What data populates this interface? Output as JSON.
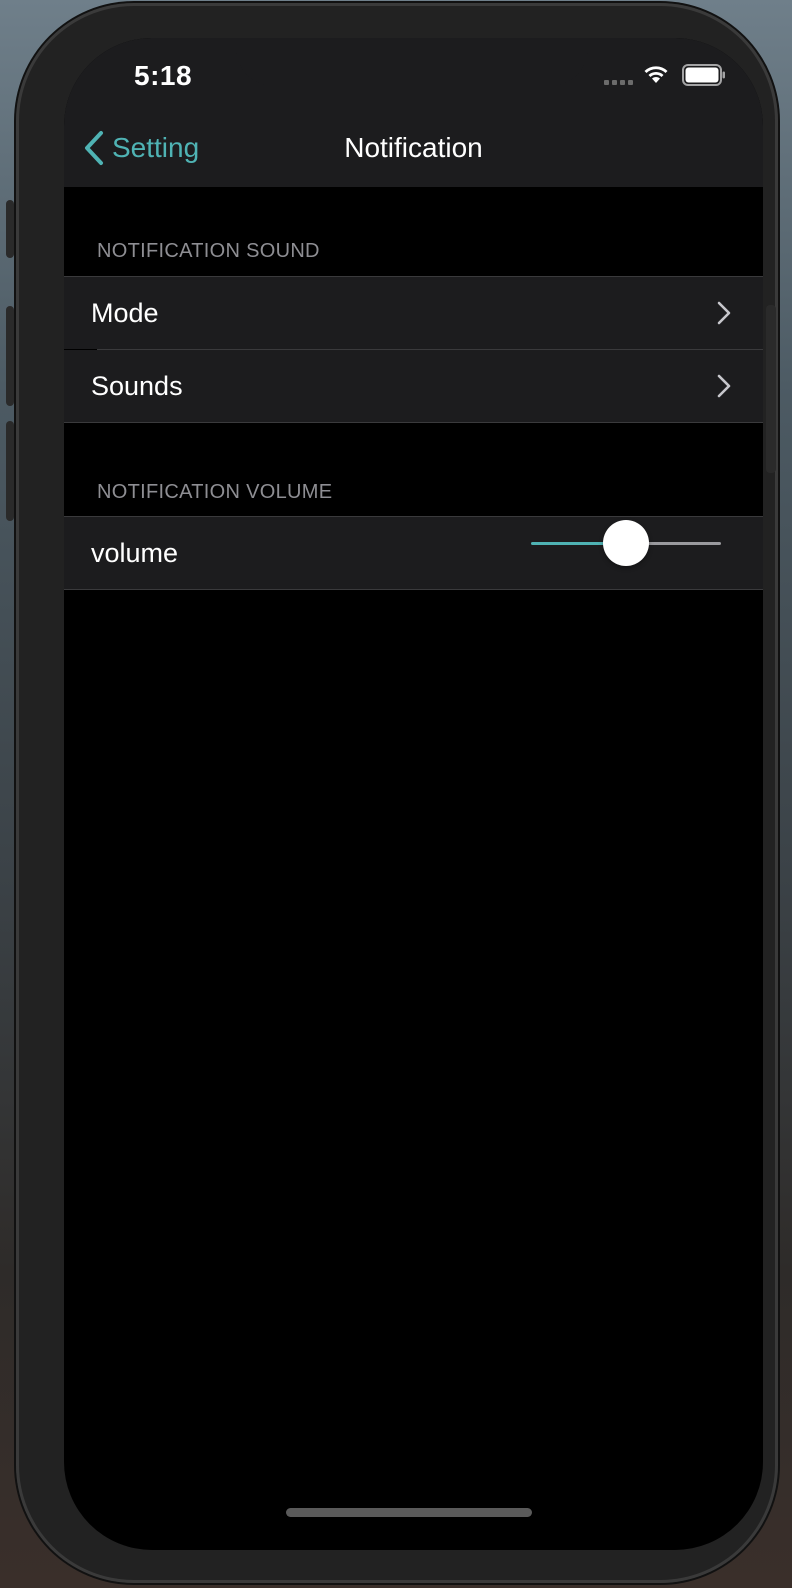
{
  "status_bar": {
    "time": "5:18",
    "signal_icon": "cellular-signal-icon",
    "wifi_icon": "wifi-icon",
    "battery_icon": "battery-icon"
  },
  "nav_bar": {
    "back_label": "Setting",
    "back_icon": "chevron-left-icon",
    "title": "Notification"
  },
  "sections": [
    {
      "header": "NOTIFICATION SOUND",
      "rows": [
        {
          "label": "Mode",
          "accessory": "chevron-right-icon"
        },
        {
          "label": "Sounds",
          "accessory": "chevron-right-icon"
        }
      ]
    },
    {
      "header": "NOTIFICATION VOLUME",
      "rows": [
        {
          "label": "volume",
          "control": "slider",
          "value": 0.5
        }
      ]
    }
  ],
  "colors": {
    "accent": "#4fb3b4",
    "background": "#000000",
    "cell_background": "#1c1c1e",
    "section_header_text": "#8e8e93",
    "separator": "#3a3a3c"
  }
}
